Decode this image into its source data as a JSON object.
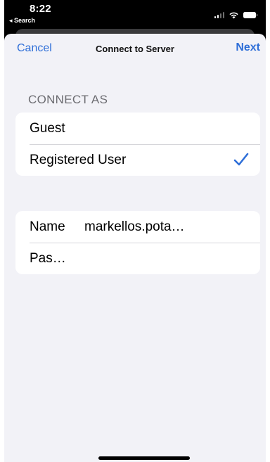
{
  "status_bar": {
    "time": "8:22",
    "back_label": "◂ Search"
  },
  "nav": {
    "cancel_label": "Cancel",
    "title": "Connect to Server",
    "next_label": "Next"
  },
  "connect_as": {
    "header": "CONNECT AS",
    "options": [
      {
        "label": "Guest",
        "selected": false
      },
      {
        "label": "Registered User",
        "selected": true
      }
    ]
  },
  "credentials": {
    "name_label": "Name",
    "name_value": "markellos.pota…",
    "password_placeholder": "Pas…"
  },
  "colors": {
    "accent": "#2f6fd8",
    "background": "#f2f2f7"
  }
}
